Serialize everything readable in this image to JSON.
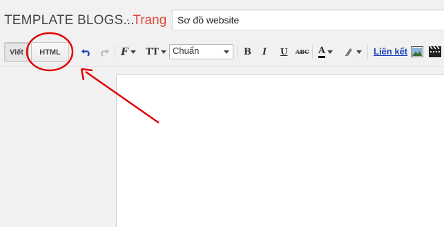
{
  "header": {
    "blog_title": "TEMPLATE BLOGS...",
    "page_type": "Trang",
    "title_value": "Sơ đồ website"
  },
  "toolbar": {
    "compose_label": "Viết",
    "html_label": "HTML",
    "format_value": "Chuẩn",
    "link_label": "Liên kết",
    "font_label": "F",
    "size_label": "TT",
    "bold_label": "B",
    "italic_label": "I",
    "underline_label": "U",
    "strike_label": "ABC",
    "text_color_label": "A"
  },
  "icons": {
    "undo": "undo-icon",
    "redo": "redo-icon",
    "highlight": "highlight-icon",
    "image": "image-icon",
    "video": "video-icon"
  },
  "colors": {
    "accent": "#dd4b39",
    "link": "#1a3fb8",
    "annotation": "#e00000"
  }
}
